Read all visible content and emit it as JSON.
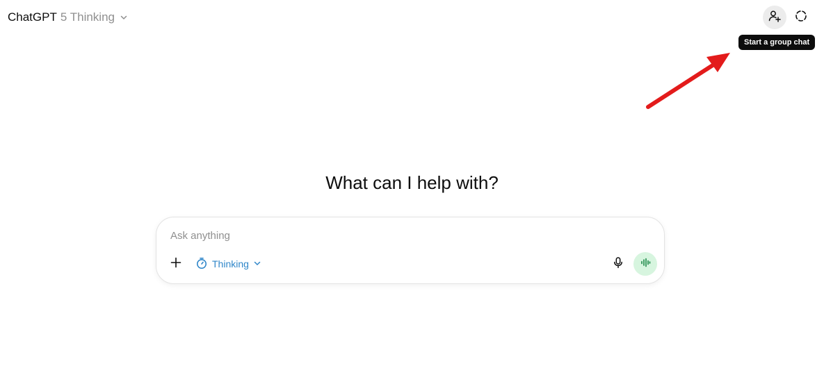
{
  "header": {
    "model_name": "ChatGPT",
    "model_variant": "5 Thinking",
    "group_chat_tooltip": "Start a group chat"
  },
  "hero": {
    "title": "What can I help with?"
  },
  "composer": {
    "placeholder": "Ask anything",
    "value": "",
    "mode_label": "Thinking"
  },
  "icons": {
    "model_dropdown": "chevron-down-icon",
    "group_chat": "add-person-icon",
    "temporary_chat": "dashed-circle-icon",
    "attach": "plus-icon",
    "mode": "timer-icon",
    "mode_dropdown": "chevron-down-icon",
    "dictate": "microphone-icon",
    "voice": "waveform-icon"
  },
  "colors": {
    "mode_accent": "#2f86c9",
    "voice_bg": "#d7f5df",
    "voice_fg": "#1e8a4a",
    "tooltip_bg": "#0d0d0d",
    "annotation_arrow": "#e31b1b"
  }
}
